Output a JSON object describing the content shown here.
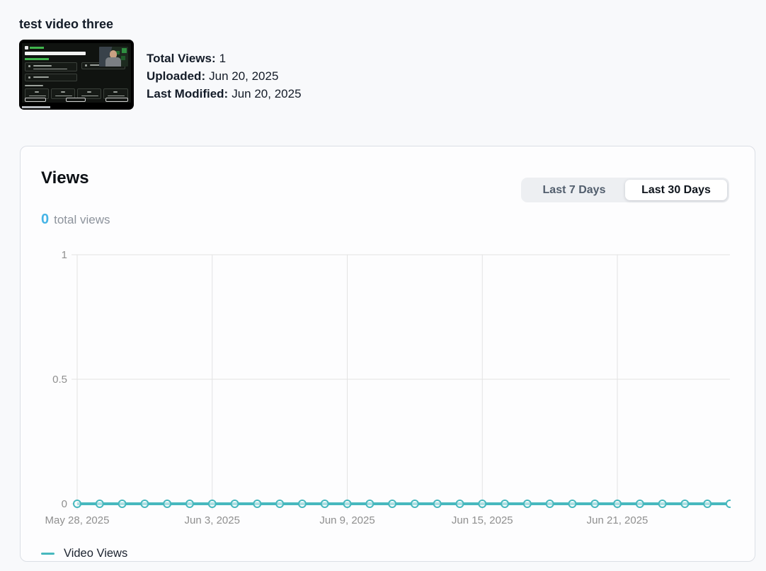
{
  "page": {
    "title": "test video three"
  },
  "video": {
    "thumbnail_alt": "video-thumbnail",
    "meta": [
      {
        "label": "Total Views:",
        "value": "1"
      },
      {
        "label": "Uploaded:",
        "value": "Jun 20, 2025"
      },
      {
        "label": "Last Modified:",
        "value": "Jun 20, 2025"
      }
    ]
  },
  "views_card": {
    "title": "Views",
    "total_value": "0",
    "total_label": "total views",
    "accent_color": "#45b4e6",
    "range_toggle": {
      "options": [
        {
          "label": "Last 7 Days",
          "active": false
        },
        {
          "label": "Last 30 Days",
          "active": true
        }
      ]
    },
    "legend": {
      "label": "Video Views",
      "color": "#47b8be"
    }
  },
  "chart_data": {
    "type": "line",
    "title": "Views",
    "x": [
      "May 28, 2025",
      "May 29, 2025",
      "May 30, 2025",
      "May 31, 2025",
      "Jun 1, 2025",
      "Jun 2, 2025",
      "Jun 3, 2025",
      "Jun 4, 2025",
      "Jun 5, 2025",
      "Jun 6, 2025",
      "Jun 7, 2025",
      "Jun 8, 2025",
      "Jun 9, 2025",
      "Jun 10, 2025",
      "Jun 11, 2025",
      "Jun 12, 2025",
      "Jun 13, 2025",
      "Jun 14, 2025",
      "Jun 15, 2025",
      "Jun 16, 2025",
      "Jun 17, 2025",
      "Jun 18, 2025",
      "Jun 19, 2025",
      "Jun 20, 2025",
      "Jun 21, 2025",
      "Jun 22, 2025",
      "Jun 23, 2025",
      "Jun 24, 2025",
      "Jun 25, 2025",
      "Jun 26, 2025"
    ],
    "series": [
      {
        "name": "Video Views",
        "color": "#47b8be",
        "values": [
          0,
          0,
          0,
          0,
          0,
          0,
          0,
          0,
          0,
          0,
          0,
          0,
          0,
          0,
          0,
          0,
          0,
          0,
          0,
          0,
          0,
          0,
          0,
          0,
          0,
          0,
          0,
          0,
          0,
          0
        ]
      }
    ],
    "x_tick_labels": [
      "May 28, 2025",
      "Jun 3, 2025",
      "Jun 9, 2025",
      "Jun 15, 2025",
      "Jun 21, 2025"
    ],
    "x_tick_indices": [
      0,
      6,
      12,
      18,
      24
    ],
    "y_ticks": [
      0,
      0.5,
      1
    ],
    "ylim": [
      0,
      1
    ],
    "grid": true,
    "legend_position": "bottom",
    "xlabel": "",
    "ylabel": ""
  }
}
